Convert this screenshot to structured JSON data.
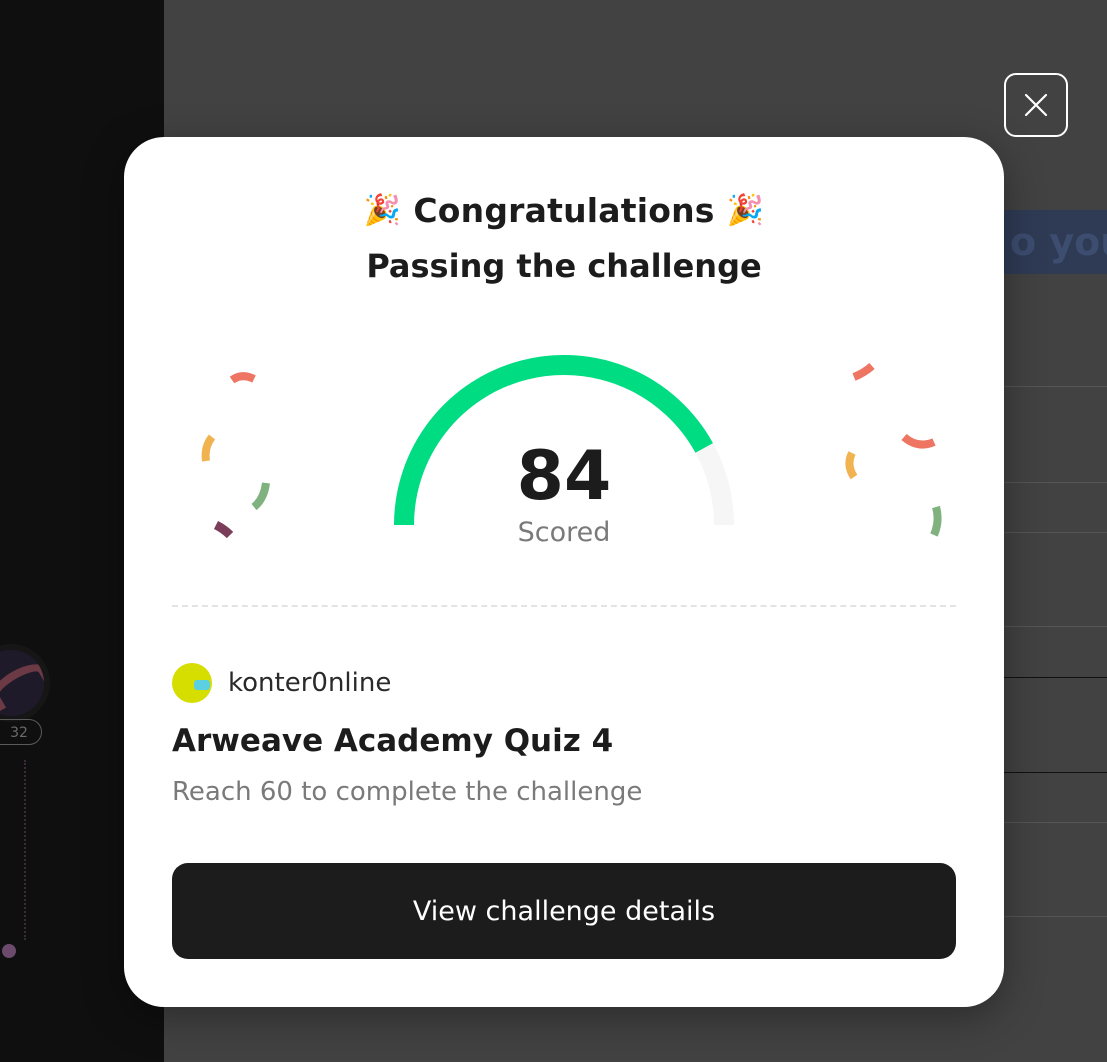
{
  "background": {
    "badge_count": "32",
    "right_strip_text": "o you"
  },
  "close": {
    "icon": "close-icon"
  },
  "modal": {
    "title": "Congratulations",
    "title_emoji": "🎉",
    "subtitle": "Passing the challenge",
    "score": {
      "value": "84",
      "label": "Scored",
      "progress": 0.84
    },
    "user": {
      "name": "konter0nline",
      "avatar_color": "#d6de00"
    },
    "challenge_title": "Arweave Academy Quiz 4",
    "challenge_desc": "Reach 60 to complete the challenge",
    "cta_label": "View challenge details"
  },
  "colors": {
    "gauge_fill": "#00dc82",
    "gauge_track": "#f6f6f6",
    "confetti": [
      "#ef7563",
      "#f1b250",
      "#7fb27f",
      "#7a3e5b"
    ]
  }
}
